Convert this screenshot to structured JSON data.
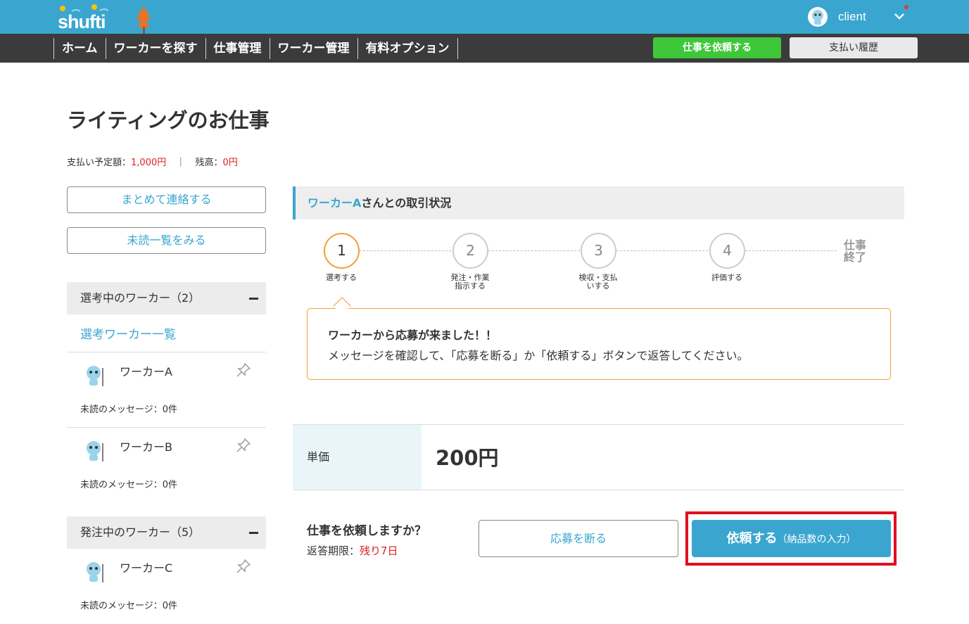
{
  "brand": {
    "logo_text": "shufti",
    "accent": "#3aa6cf"
  },
  "user": {
    "name": "client",
    "menu_icon": "chevron-down-icon"
  },
  "nav": {
    "items": [
      "ホーム",
      "ワーカーを探す",
      "仕事管理",
      "ワーカー管理",
      "有料オプション"
    ],
    "request_label": "仕事を依頼する",
    "history_label": "支払い履歴"
  },
  "page": {
    "title": "ライティングのお仕事"
  },
  "balance": {
    "planned_label": "支払い予定額：",
    "planned_value": "1,000円",
    "separator": "｜",
    "remaining_label": "残高：",
    "remaining_value": "0円"
  },
  "sidebar": {
    "bulk_contact": "まとめて連絡する",
    "unread_list": "未読一覧をみる",
    "selecting": {
      "header": "選考中のワーカー（2）",
      "list_link": "選考ワーカー一覧",
      "workers": [
        {
          "name": "ワーカーA",
          "unread": "未読のメッセージ：0件"
        },
        {
          "name": "ワーカーB",
          "unread": "未読のメッセージ：0件"
        }
      ]
    },
    "ordering": {
      "header": "発注中のワーカー（5）",
      "workers": [
        {
          "name": "ワーカーC",
          "unread": "未読のメッセージ：0件"
        }
      ]
    }
  },
  "status": {
    "worker_name": "ワーカーA",
    "header_suffix": "さんとの取引状況",
    "steps": [
      {
        "num": "1",
        "label": "選考する"
      },
      {
        "num": "2",
        "label": "発注・作業指示する"
      },
      {
        "num": "3",
        "label": "検収・支払いする"
      },
      {
        "num": "4",
        "label": "評価する"
      }
    ],
    "end_label": "仕事終了",
    "current_step": 1
  },
  "message": {
    "title": "ワーカーから応募が来ました！！",
    "body": "メッセージを確認して、「応募を断る」か「依頼する」ボタンで返答してください。"
  },
  "price": {
    "label": "単価",
    "value": "200円"
  },
  "question": {
    "title": "仕事を依頼しますか？",
    "deadline_label": "返答期限：",
    "deadline_value": "残り7日",
    "decline_label": "応募を断る",
    "accept_label": "依頼する",
    "accept_sub": "（納品数の入力）"
  }
}
